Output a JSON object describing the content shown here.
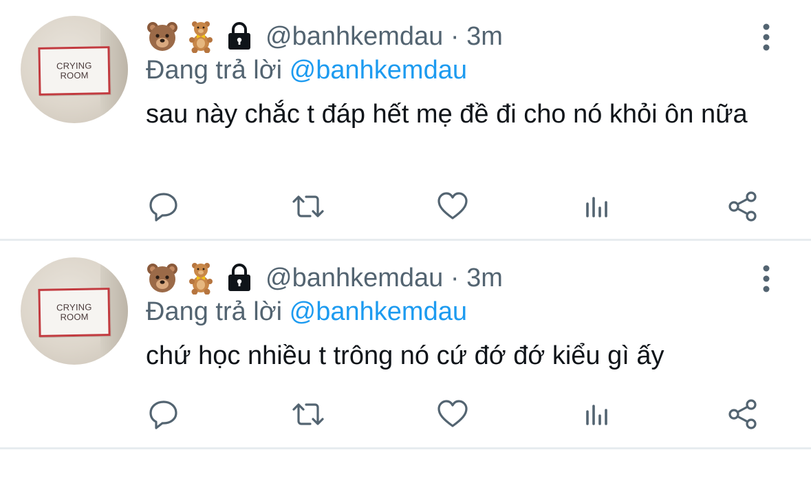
{
  "tweets": [
    {
      "avatar": {
        "sign_line1": "CRYING",
        "sign_line2": "ROOM"
      },
      "name_icons": [
        "bear-face-icon",
        "teddy-bear-icon",
        "lock-icon"
      ],
      "handle": "@banhkemdau",
      "separator": "·",
      "time": "3m",
      "reply_prefix": "Đang trả lời",
      "reply_mention": "@banhkemdau",
      "text": "sau này chắc t đáp hết mẹ đề đi cho nó khỏi ôn nữa",
      "actions": [
        "reply-icon",
        "retweet-icon",
        "like-icon",
        "views-icon",
        "share-icon"
      ]
    },
    {
      "avatar": {
        "sign_line1": "CRYING",
        "sign_line2": "ROOM"
      },
      "name_icons": [
        "bear-face-icon",
        "teddy-bear-icon",
        "lock-icon"
      ],
      "handle": "@banhkemdau",
      "separator": "·",
      "time": "3m",
      "reply_prefix": "Đang trả lời",
      "reply_mention": "@banhkemdau",
      "text": "chứ học nhiều t trông nó cứ đớ đớ kiểu gì ấy",
      "actions": [
        "reply-icon",
        "retweet-icon",
        "like-icon",
        "views-icon",
        "share-icon"
      ]
    }
  ],
  "colors": {
    "secondary_text": "#536471",
    "mention": "#1d9bf0",
    "primary_text": "#0f1419",
    "divider": "#e7ecef"
  }
}
